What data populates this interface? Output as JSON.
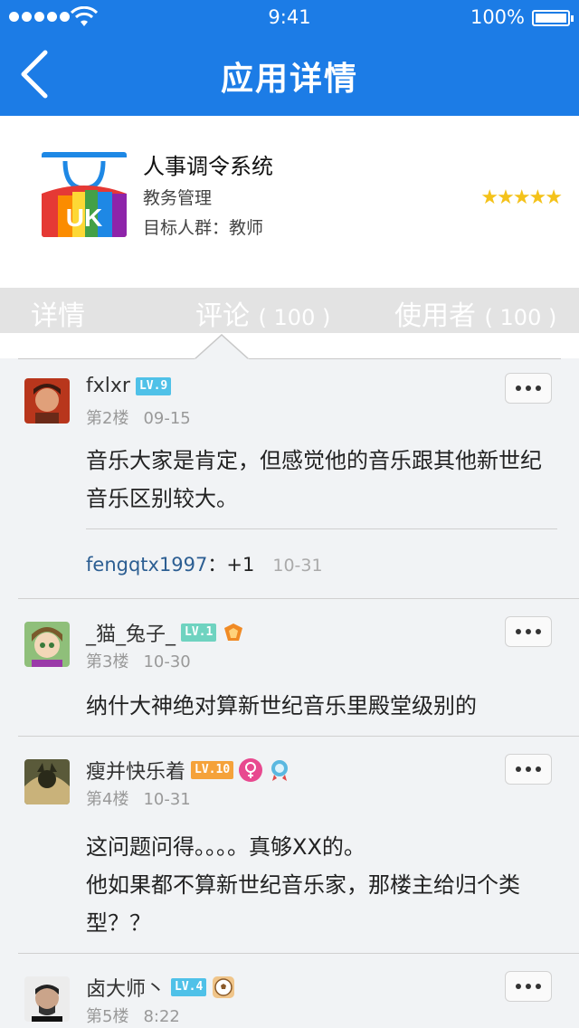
{
  "status": {
    "time": "9:41",
    "battery": "100%"
  },
  "nav": {
    "title": "应用详情"
  },
  "app": {
    "name": "人事调令系统",
    "category": "教务管理",
    "target": "目标人群：教师",
    "icon_text": "UK",
    "rating": "★★★★★"
  },
  "tabs": [
    {
      "label": "详情",
      "count": ""
    },
    {
      "label": "评论",
      "count": "( 100 )"
    },
    {
      "label": "使用者",
      "count": "( 100 )"
    }
  ],
  "comments": [
    {
      "user": "fxlxr",
      "level": "LV.9",
      "floor": "第2楼",
      "date": "09-15",
      "text": "音乐大家是肯定，但感觉他的音乐跟其他新世纪音乐区别较大。",
      "reply": {
        "user": "fengqtx1997",
        "text": "：+1",
        "date": "10-31"
      }
    },
    {
      "user": "_猫_兔子_",
      "level": "LV.1",
      "floor": "第3楼",
      "date": "10-30",
      "text": "纳什大神绝对算新世纪音乐里殿堂级别的"
    },
    {
      "user": "瘦并快乐着",
      "level": "LV.10",
      "floor": "第4楼",
      "date": "10-31",
      "text_lines": [
        "这问题问得。。。。真够XX的。",
        "他如果都不算新世纪音乐家，那楼主给归个类型？？"
      ]
    },
    {
      "user": "卤大师丶",
      "level": "LV.4",
      "floor": "第5楼",
      "date": "8:22"
    }
  ]
}
